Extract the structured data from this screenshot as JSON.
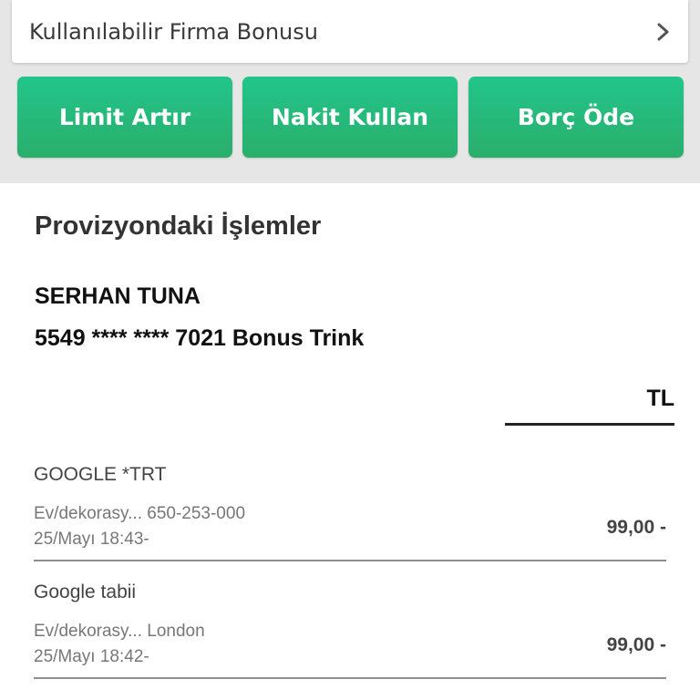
{
  "bonus": {
    "label": "Kullanılabilir Firma Bonusu"
  },
  "actions": [
    {
      "label": "Limit Artır"
    },
    {
      "label": "Nakit Kullan"
    },
    {
      "label": "Borç Öde"
    }
  ],
  "section": {
    "title": "Provizyondaki İşlemler"
  },
  "card": {
    "holder": "SERHAN TUNA",
    "number": "5549 **** **** 7021 Bonus Trink"
  },
  "table": {
    "currency_header": "TL"
  },
  "transactions": [
    {
      "merchant": "GOOGLE *TRT",
      "detail": "Ev/dekorasy... 650-253-000",
      "date": "25/Mayı 18:43-",
      "amount": "99,00 -"
    },
    {
      "merchant": "Google tabii",
      "detail": "Ev/dekorasy... London",
      "date": "25/Mayı 18:42-",
      "amount": "99,00 -"
    }
  ],
  "icons": {
    "bonus_chevron": "chevron-right-icon"
  },
  "colors": {
    "accent_green": "#2bbf7e",
    "button_text": "#ffffff",
    "background_band": "#e6e6e6"
  }
}
